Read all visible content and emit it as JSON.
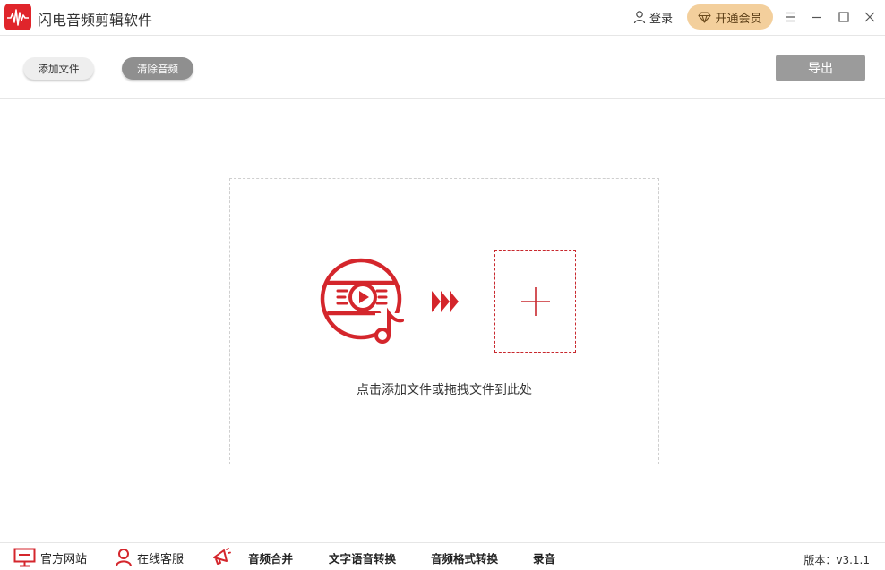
{
  "titlebar": {
    "title": "闪电音频剪辑软件",
    "login_label": "登录",
    "vip_label": "开通会员"
  },
  "toolbar": {
    "add_file_label": "添加文件",
    "clear_audio_label": "清除音频",
    "export_label": "导出"
  },
  "dropzone": {
    "hint": "点击添加文件或拖拽文件到此处"
  },
  "footer": {
    "items": [
      {
        "label": "官方网站",
        "icon": "monitor-icon"
      },
      {
        "label": "在线客服",
        "icon": "user-service-icon"
      },
      {
        "label": "音频合并",
        "icon": "megaphone-icon"
      },
      {
        "label": "文字语音转换"
      },
      {
        "label": "音频格式转换"
      },
      {
        "label": "录音"
      }
    ],
    "version": "版本：v3.1.1"
  },
  "colors": {
    "brand_red": "#e0252b",
    "vip_gold": "#f3cf9c",
    "button_gray": "#8f8f8f"
  }
}
